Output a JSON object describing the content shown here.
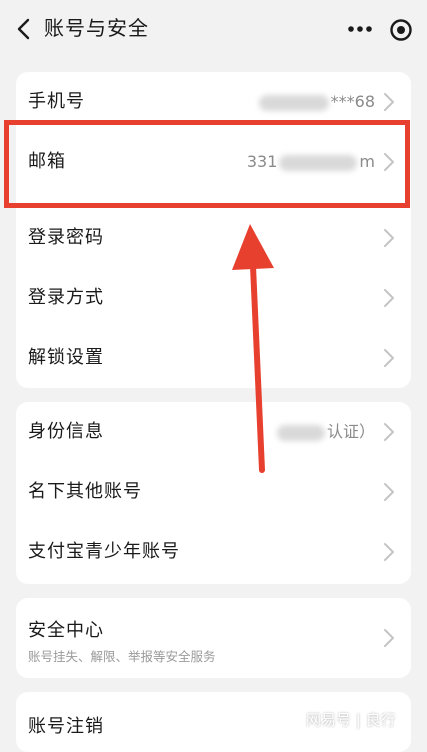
{
  "header": {
    "title": "账号与安全",
    "icons": {
      "back": "chevron-left-icon",
      "more": "more-dots-icon",
      "target": "target-icon"
    }
  },
  "section1": {
    "rows": [
      {
        "label": "手机号",
        "value": "***68"
      },
      {
        "label": "邮箱",
        "value_prefix": "331",
        "value_suffix": "m"
      },
      {
        "label": "登录密码"
      },
      {
        "label": "登录方式"
      },
      {
        "label": "解锁设置"
      }
    ]
  },
  "section2": {
    "rows": [
      {
        "label": "身份信息",
        "value": "认证）"
      },
      {
        "label": "名下其他账号"
      },
      {
        "label": "支付宝青少年账号"
      }
    ]
  },
  "section3": {
    "title": "安全中心",
    "subtitle": "账号挂失、解限、举报等安全服务"
  },
  "section4": {
    "title": "账号注销"
  },
  "watermark": "网易号 | 良行",
  "colors": {
    "highlight": "#e8402f",
    "background": "#f2f2f2",
    "card": "#ffffff",
    "secondary_text": "#8a8a8a"
  }
}
